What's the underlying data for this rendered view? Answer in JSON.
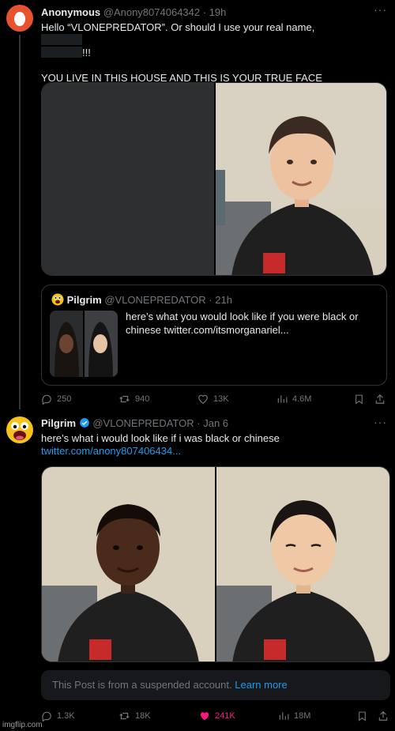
{
  "post1": {
    "author_name": "Anonymous",
    "handle": "@Anony8074064342",
    "separator": "·",
    "time": "19h",
    "more": "···",
    "text_line1": "Hello “VLONEPREDATOR”. Or should I use your real name,",
    "text_line2_suffix": "!!!",
    "text_line3": "YOU LIVE IN THIS HOUSE AND THIS IS YOUR TRUE FACE",
    "quote": {
      "author_name": "Pilgrim",
      "handle": "@VLONEPREDATOR",
      "separator": "·",
      "time": "21h",
      "text": "here’s what you would look like if you were black or chinese  twitter.com/itsmorganariel..."
    },
    "actions": {
      "replies": "250",
      "reposts": "940",
      "likes": "13K",
      "views": "4.6M"
    }
  },
  "post2": {
    "author_name": "Pilgrim",
    "handle": "@VLONEPREDATOR",
    "separator": "·",
    "time": "Jan 6",
    "more": "···",
    "text": "here’s what i would look like if i was black or chinese",
    "link": "twitter.com/anony807406434...",
    "suspended_text": "This Post is from a suspended account.",
    "suspended_link": "Learn more",
    "actions": {
      "replies": "1.3K",
      "reposts": "18K",
      "likes": "241K",
      "views": "18M"
    }
  },
  "colors": {
    "background": "#000000",
    "secondary_text": "#71767b",
    "link": "#1d9bf0",
    "like_active": "#f91880",
    "anonymous_avatar": "#e8522e"
  },
  "icons": [
    "reply-icon",
    "repost-icon",
    "like-icon",
    "views-icon",
    "bookmark-icon",
    "share-icon",
    "verified-badge-icon",
    "emoji-avatar-icon"
  ],
  "watermark": "imgflip.com"
}
